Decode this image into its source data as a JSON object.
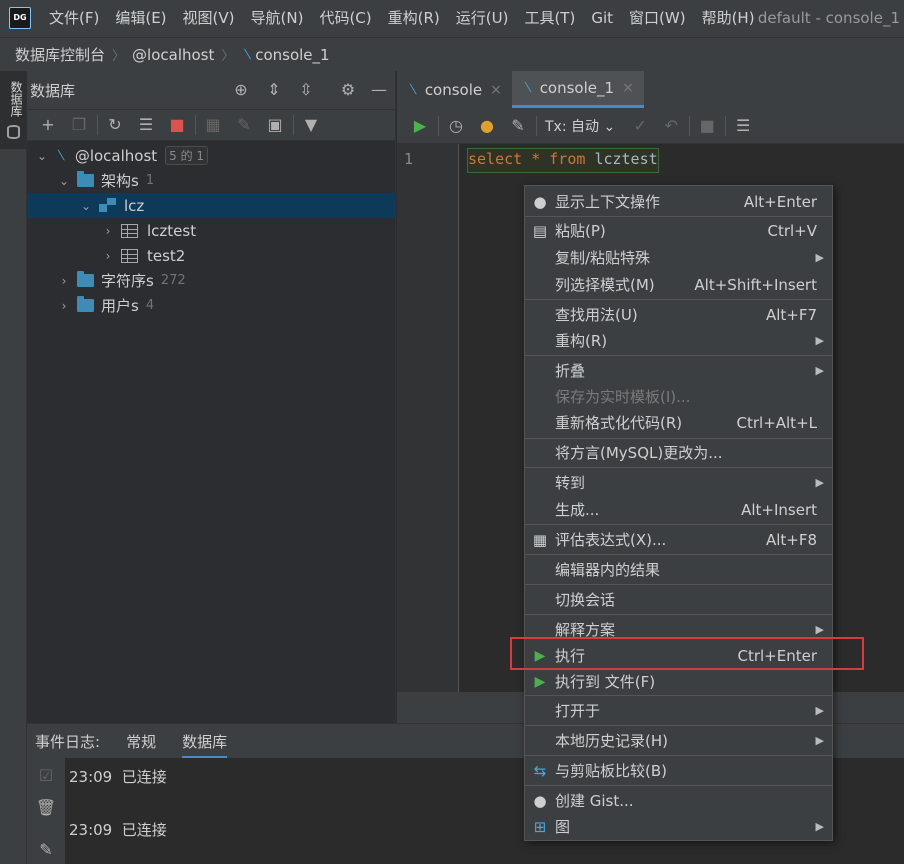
{
  "menubar": {
    "logo_text": "DG",
    "items": [
      "文件(F)",
      "编辑(E)",
      "视图(V)",
      "导航(N)",
      "代码(C)",
      "重构(R)",
      "运行(U)",
      "工具(T)",
      "Git",
      "窗口(W)",
      "帮助(H)"
    ],
    "window_title": "default - console_1"
  },
  "breadcrumb": {
    "items": [
      "数据库控制台",
      "@localhost",
      "console_1"
    ]
  },
  "left_strip": {
    "label": "数据库"
  },
  "db_panel": {
    "title": "数据库",
    "tree": [
      {
        "label": "@localhost",
        "badge": "5 的 1",
        "level": 0
      },
      {
        "label": "架构s",
        "count": "1",
        "level": 1
      },
      {
        "label": "lcz",
        "level": 2,
        "selected": true
      },
      {
        "label": "lcztest",
        "level": 3
      },
      {
        "label": "test2",
        "level": 3
      },
      {
        "label": "字符序s",
        "count": "272",
        "level": 1
      },
      {
        "label": "用户s",
        "count": "4",
        "level": 1
      }
    ]
  },
  "editor": {
    "tabs": [
      "console",
      "console_1"
    ],
    "active_tab": "console_1",
    "tx_label": "Tx: 自动",
    "line_number": "1",
    "code": {
      "kw1": "select",
      "star": "*",
      "kw2": "from",
      "table": "lcztest"
    }
  },
  "bottom": {
    "tabs": [
      "事件日志:",
      "常规",
      "数据库"
    ],
    "logs": [
      {
        "time": "23:09",
        "text": "已连接"
      },
      {
        "time": "23:09",
        "text": "已连接"
      }
    ]
  },
  "context_menu": {
    "items": [
      {
        "label": "显示上下文操作",
        "shortcut": "Alt+Enter",
        "icon": "bulb-icon"
      },
      {
        "label": "粘贴(P)",
        "shortcut": "Ctrl+V",
        "icon": "paste-icon"
      },
      {
        "label": "复制/粘贴特殊",
        "submenu": true
      },
      {
        "label": "列选择模式(M)",
        "shortcut": "Alt+Shift+Insert"
      },
      {
        "label": "查找用法(U)",
        "shortcut": "Alt+F7"
      },
      {
        "label": "重构(R)",
        "submenu": true
      },
      {
        "label": "折叠",
        "submenu": true
      },
      {
        "label": "保存为实时模板(I)...",
        "disabled": true
      },
      {
        "label": "重新格式化代码(R)",
        "shortcut": "Ctrl+Alt+L"
      },
      {
        "label": "将方言(MySQL)更改为..."
      },
      {
        "label": "转到",
        "submenu": true
      },
      {
        "label": "生成...",
        "shortcut": "Alt+Insert"
      },
      {
        "label": "评估表达式(X)...",
        "shortcut": "Alt+F8",
        "icon": "calculator-icon"
      },
      {
        "label": "编辑器内的结果"
      },
      {
        "label": "切换会话"
      },
      {
        "label": "解释方案",
        "submenu": true
      },
      {
        "label": "执行",
        "shortcut": "Ctrl+Enter",
        "icon": "play-icon"
      },
      {
        "label": "执行到 文件(F)",
        "icon": "play-icon"
      },
      {
        "label": "打开于",
        "submenu": true
      },
      {
        "label": "本地历史记录(H)",
        "submenu": true
      },
      {
        "label": "与剪贴板比较(B)",
        "icon": "compare-icon"
      },
      {
        "label": "创建 Gist...",
        "icon": "github-icon"
      },
      {
        "label": "图",
        "submenu": true,
        "icon": "diagram-icon"
      }
    ]
  },
  "colors": {
    "accent": "#4a88c7",
    "selection": "#0d3a58",
    "highlight_box": "#d83b3b",
    "keyword": "#cc7832",
    "run_green": "#4caf50"
  }
}
